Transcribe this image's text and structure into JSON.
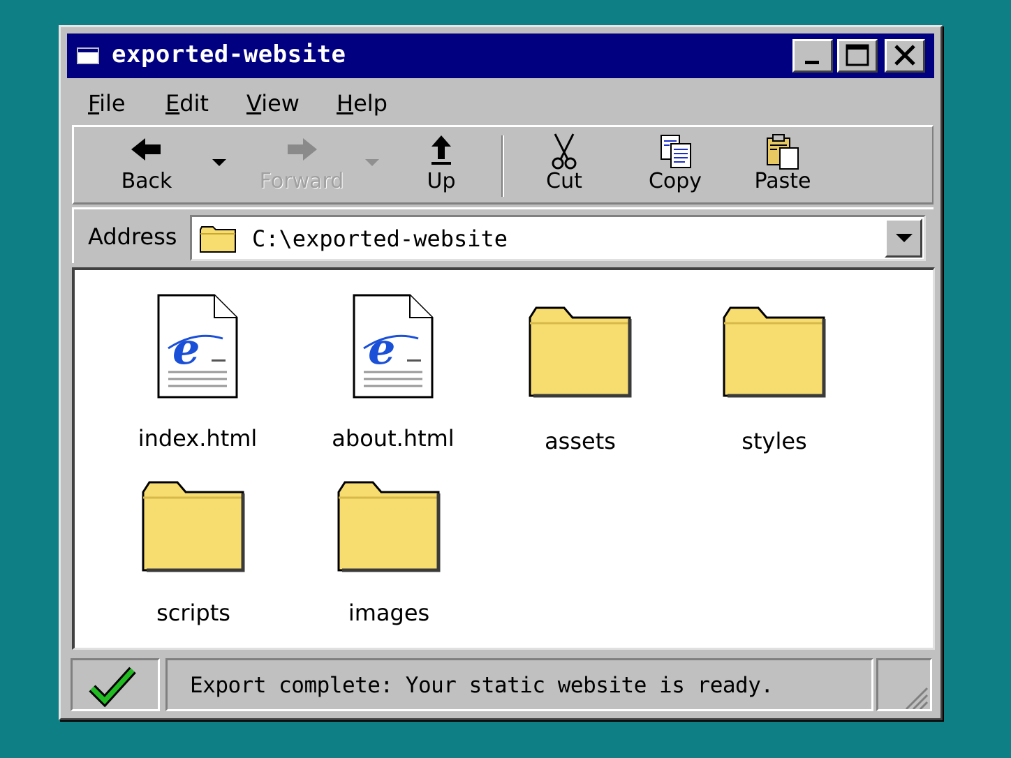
{
  "window": {
    "title": "exported-website",
    "controls": {
      "minimize": "minimize",
      "maximize": "maximize",
      "close": "close"
    }
  },
  "menu": {
    "items": [
      {
        "accel": "F",
        "rest": "ile"
      },
      {
        "accel": "E",
        "rest": "dit"
      },
      {
        "accel": "V",
        "rest": "iew"
      },
      {
        "accel": "H",
        "rest": "elp"
      }
    ]
  },
  "toolbar": {
    "back": "Back",
    "forward": "Forward",
    "up": "Up",
    "cut": "Cut",
    "copy": "Copy",
    "paste": "Paste"
  },
  "address": {
    "label": "Address",
    "path": "C:\\exported-website"
  },
  "files": [
    {
      "name": "index.html",
      "icon": "html-document-icon"
    },
    {
      "name": "about.html",
      "icon": "html-document-icon"
    },
    {
      "name": "assets",
      "icon": "folder-icon"
    },
    {
      "name": "styles",
      "icon": "folder-icon"
    },
    {
      "name": "scripts",
      "icon": "folder-icon"
    },
    {
      "name": "images",
      "icon": "folder-icon"
    }
  ],
  "status": {
    "message": "Export complete: Your static website is ready.",
    "icon": "checkmark-icon"
  },
  "colors": {
    "desktop": "#0f7f86",
    "titlebar": "#000080",
    "folder": "#f7dc6f",
    "check": "#22bb22"
  }
}
